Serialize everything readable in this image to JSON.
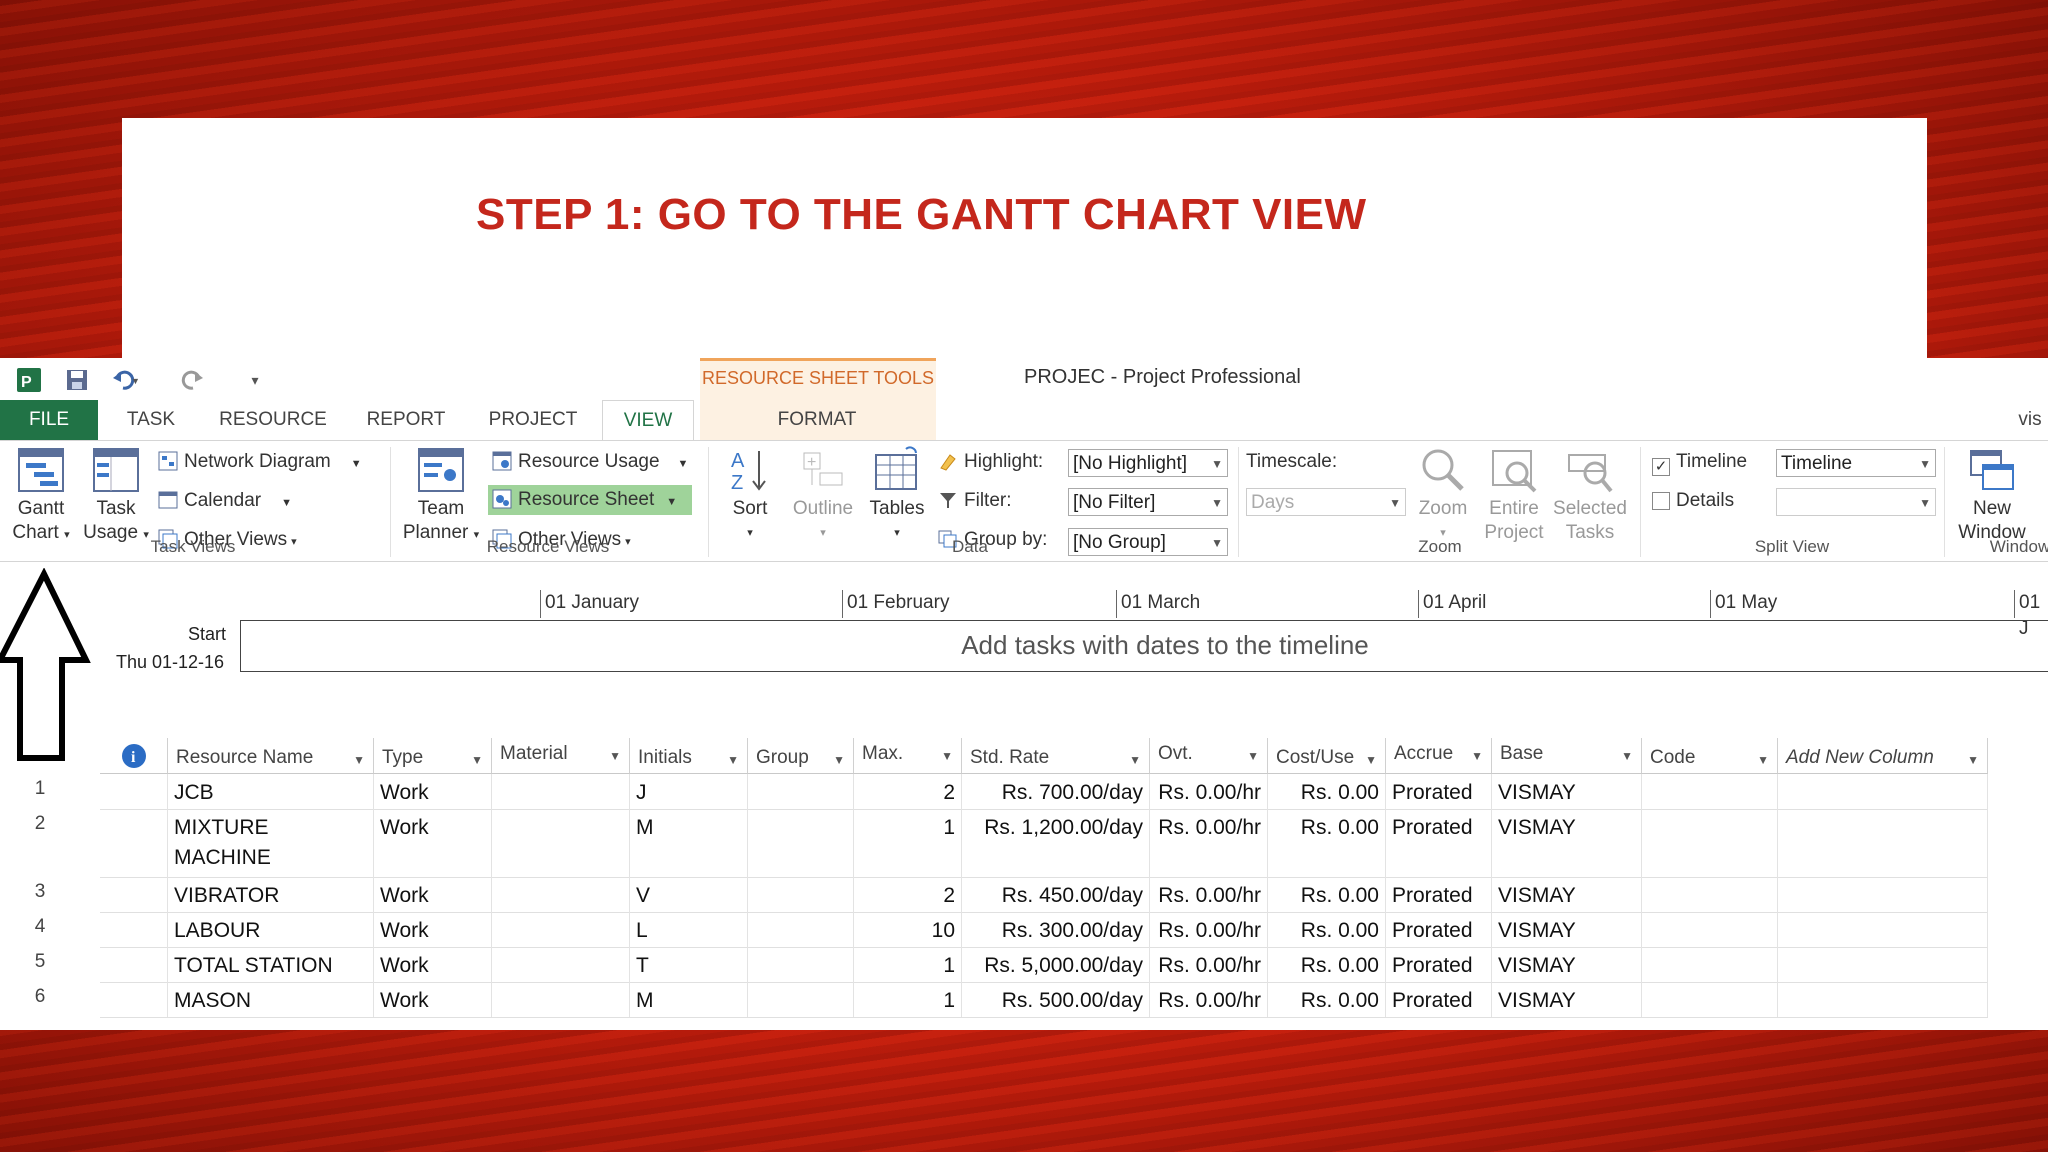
{
  "slide": {
    "title": "STEP 1: GO TO THE GANTT CHART VIEW"
  },
  "window": {
    "context_tab_label": "RESOURCE SHEET TOOLS",
    "title": "PROJEC - Project Professional",
    "user": "vis"
  },
  "tabs": [
    {
      "label": "FILE"
    },
    {
      "label": "TASK"
    },
    {
      "label": "RESOURCE"
    },
    {
      "label": "REPORT"
    },
    {
      "label": "PROJECT"
    },
    {
      "label": "VIEW"
    },
    {
      "label": "FORMAT"
    }
  ],
  "ribbon": {
    "task_views": {
      "label": "Task Views",
      "gantt_line1": "Gantt",
      "gantt_line2": "Chart",
      "task_usage_line1": "Task",
      "task_usage_line2": "Usage",
      "network_diagram": "Network Diagram",
      "calendar": "Calendar",
      "other_views": "Other Views"
    },
    "resource_views": {
      "label": "Resource Views",
      "team_planner_line1": "Team",
      "team_planner_line2": "Planner",
      "resource_usage": "Resource Usage",
      "resource_sheet": "Resource Sheet",
      "other_views": "Other Views"
    },
    "data": {
      "label": "Data",
      "sort": "Sort",
      "outline": "Outline",
      "tables": "Tables",
      "highlight_label": "Highlight:",
      "highlight_value": "[No Highlight]",
      "filter_label": "Filter:",
      "filter_value": "[No Filter]",
      "group_label": "Group by:",
      "group_value": "[No Group]"
    },
    "zoom": {
      "label": "Zoom",
      "timescale_label": "Timescale:",
      "timescale_value": "Days",
      "zoom": "Zoom",
      "entire_line1": "Entire",
      "entire_line2": "Project",
      "selected_line1": "Selected",
      "selected_line2": "Tasks"
    },
    "split_view": {
      "label": "Split View",
      "timeline": "Timeline",
      "timeline_checked": true,
      "timeline_value": "Timeline",
      "details": "Details",
      "details_checked": false
    },
    "window": {
      "label": "Window",
      "new_line1": "New",
      "new_line2": "Window"
    }
  },
  "timeline": {
    "months": [
      "01 January",
      "01 February",
      "01 March",
      "01 April",
      "01 May",
      "01 J"
    ],
    "start_label": "Start",
    "start_date": "Thu 01-12-16",
    "empty_message": "Add tasks with dates to the timeline"
  },
  "sheet": {
    "columns": [
      "Resource Name",
      "Type",
      "Material",
      "Initials",
      "Group",
      "Max.",
      "Std. Rate",
      "Ovt.",
      "Cost/Use",
      "Accrue",
      "Base",
      "Code",
      "Add New Column"
    ],
    "rows": [
      {
        "id": "1",
        "name": "JCB",
        "type": "Work",
        "material": "",
        "initials": "J",
        "group": "",
        "max": "2",
        "std_rate": "Rs. 700.00/day",
        "ovt": "Rs. 0.00/hr",
        "cost_use": "Rs. 0.00",
        "accrue": "Prorated",
        "base": "VISMAY",
        "code": ""
      },
      {
        "id": "2",
        "name": "MIXTURE MACHINE",
        "type": "Work",
        "material": "",
        "initials": "M",
        "group": "",
        "max": "1",
        "std_rate": "Rs. 1,200.00/day",
        "ovt": "Rs. 0.00/hr",
        "cost_use": "Rs. 0.00",
        "accrue": "Prorated",
        "base": "VISMAY",
        "code": ""
      },
      {
        "id": "3",
        "name": "VIBRATOR",
        "type": "Work",
        "material": "",
        "initials": "V",
        "group": "",
        "max": "2",
        "std_rate": "Rs. 450.00/day",
        "ovt": "Rs. 0.00/hr",
        "cost_use": "Rs. 0.00",
        "accrue": "Prorated",
        "base": "VISMAY",
        "code": ""
      },
      {
        "id": "4",
        "name": "LABOUR",
        "type": "Work",
        "material": "",
        "initials": "L",
        "group": "",
        "max": "10",
        "std_rate": "Rs. 300.00/day",
        "ovt": "Rs. 0.00/hr",
        "cost_use": "Rs. 0.00",
        "accrue": "Prorated",
        "base": "VISMAY",
        "code": ""
      },
      {
        "id": "5",
        "name": "TOTAL STATION",
        "type": "Work",
        "material": "",
        "initials": "T",
        "group": "",
        "max": "1",
        "std_rate": "Rs. 5,000.00/day",
        "ovt": "Rs. 0.00/hr",
        "cost_use": "Rs. 0.00",
        "accrue": "Prorated",
        "base": "VISMAY",
        "code": ""
      },
      {
        "id": "6",
        "name": "MASON",
        "type": "Work",
        "material": "",
        "initials": "M",
        "group": "",
        "max": "1",
        "std_rate": "Rs. 500.00/day",
        "ovt": "Rs. 0.00/hr",
        "cost_use": "Rs. 0.00",
        "accrue": "Prorated",
        "base": "VISMAY",
        "code": ""
      }
    ]
  },
  "colors": {
    "file_tab": "#217346",
    "title": "#c4271c",
    "context": "#d1692a",
    "highlight": "#9fd39a"
  }
}
